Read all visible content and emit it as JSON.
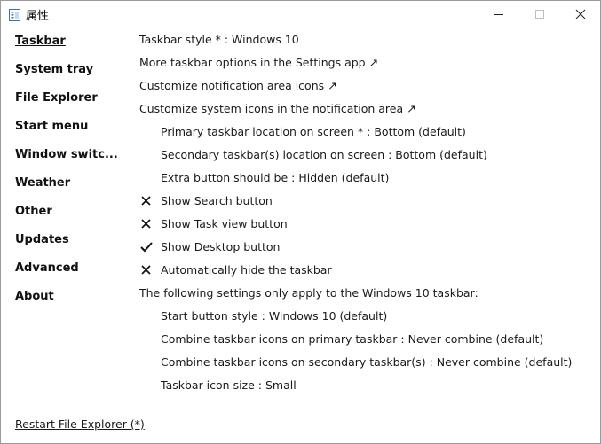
{
  "window": {
    "title": "属性"
  },
  "sidebar": {
    "items": [
      {
        "label": "Taskbar"
      },
      {
        "label": "System tray"
      },
      {
        "label": "File Explorer"
      },
      {
        "label": "Start menu"
      },
      {
        "label": "Window switc..."
      },
      {
        "label": "Weather"
      },
      {
        "label": "Other"
      },
      {
        "label": "Updates"
      },
      {
        "label": "Advanced"
      },
      {
        "label": "About"
      }
    ],
    "selected": "Taskbar"
  },
  "settings": {
    "taskbar_style": "Taskbar style * : Windows 10",
    "more_options": "More taskbar options in the Settings app ↗",
    "customize_notification_icons": "Customize notification area icons ↗",
    "customize_system_icons": "Customize system icons in the notification area ↗",
    "primary_location": "Primary taskbar location on screen * : Bottom (default)",
    "secondary_location": "Secondary taskbar(s) location on screen : Bottom (default)",
    "extra_button": "Extra button should be : Hidden (default)",
    "show_search": {
      "label": "Show Search button",
      "checked": false
    },
    "show_task_view": {
      "label": "Show Task view button",
      "checked": false
    },
    "show_desktop": {
      "label": "Show Desktop button",
      "checked": true
    },
    "auto_hide": {
      "label": "Automatically hide the taskbar",
      "checked": false
    },
    "win10_header": "The following settings only apply to the Windows 10 taskbar:",
    "start_button_style": "Start button style : Windows 10 (default)",
    "combine_primary": "Combine taskbar icons on primary taskbar : Never combine (default)",
    "combine_secondary": "Combine taskbar icons on secondary taskbar(s) : Never combine (default)",
    "icon_size": "Taskbar icon size : Small"
  },
  "footer": {
    "restart_link": "Restart File Explorer (*)"
  }
}
